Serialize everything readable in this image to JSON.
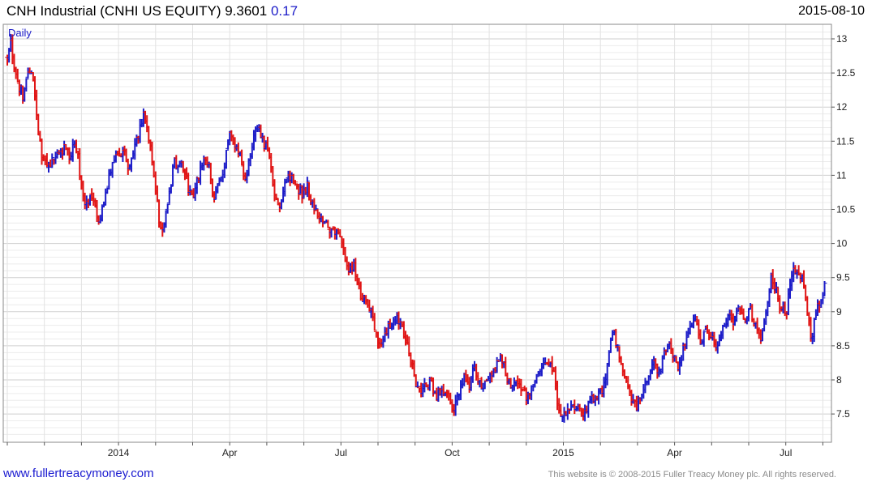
{
  "header": {
    "title": "CNH Industrial (CNHI US EQUITY) 9.3601",
    "change": "0.17",
    "date": "2015-08-10"
  },
  "footer": {
    "website": "www.fullertreacymoney.com",
    "copyright": "This website is © 2008-2015 Fuller Treacy Money plc. All rights reserved."
  },
  "colors": {
    "up": "#1c1cc8",
    "down": "#e01414",
    "grid": "#d6d6d6",
    "frame": "#8a8a8a",
    "change": "#1c1cc8"
  },
  "chart_data": {
    "type": "ohlc-bar",
    "period_label": "Daily",
    "xlabel": "",
    "ylabel": "",
    "ylim": [
      7.2,
      13.1
    ],
    "xlim": [
      -0.1,
      20.4
    ],
    "y_ticks": [
      7.5,
      8,
      8.5,
      9,
      9.5,
      10,
      10.5,
      11,
      11.5,
      12,
      12.5,
      13
    ],
    "x_ticks": [
      {
        "label": "2014",
        "pos": 3
      },
      {
        "label": "Apr",
        "pos": 6
      },
      {
        "label": "Jul",
        "pos": 9
      },
      {
        "label": "Oct",
        "pos": 12
      },
      {
        "label": "2015",
        "pos": 15
      },
      {
        "label": "Apr",
        "pos": 18
      },
      {
        "label": "Jul",
        "pos": 21
      }
    ],
    "grid": true,
    "x_unit": "month index (0 = Oct 2013)",
    "series": [
      {
        "price_path": [
          [
            0.0,
            12.7
          ],
          [
            0.1,
            12.95
          ],
          [
            0.2,
            12.5
          ],
          [
            0.3,
            12.3
          ],
          [
            0.45,
            12.15
          ],
          [
            0.55,
            12.55
          ],
          [
            0.65,
            12.45
          ],
          [
            0.75,
            12.2
          ],
          [
            0.82,
            11.75
          ],
          [
            0.88,
            11.45
          ],
          [
            0.95,
            11.2
          ],
          [
            1.1,
            11.15
          ],
          [
            1.3,
            11.25
          ],
          [
            1.5,
            11.4
          ],
          [
            1.7,
            11.3
          ],
          [
            1.85,
            11.5
          ],
          [
            1.95,
            11.05
          ],
          [
            2.1,
            10.55
          ],
          [
            2.3,
            10.7
          ],
          [
            2.45,
            10.25
          ],
          [
            2.6,
            10.55
          ],
          [
            2.75,
            11.0
          ],
          [
            2.9,
            11.3
          ],
          [
            3.1,
            11.35
          ],
          [
            3.3,
            11.1
          ],
          [
            3.5,
            11.5
          ],
          [
            3.65,
            11.9
          ],
          [
            3.8,
            11.6
          ],
          [
            3.95,
            11.05
          ],
          [
            4.1,
            10.35
          ],
          [
            4.2,
            10.2
          ],
          [
            4.35,
            10.6
          ],
          [
            4.5,
            11.2
          ],
          [
            4.7,
            11.15
          ],
          [
            4.85,
            10.9
          ],
          [
            5.0,
            10.6
          ],
          [
            5.15,
            10.95
          ],
          [
            5.3,
            11.25
          ],
          [
            5.45,
            11.1
          ],
          [
            5.55,
            10.6
          ],
          [
            5.7,
            10.9
          ],
          [
            5.85,
            11.1
          ],
          [
            6.0,
            11.6
          ],
          [
            6.15,
            11.45
          ],
          [
            6.3,
            11.3
          ],
          [
            6.4,
            10.9
          ],
          [
            6.55,
            11.25
          ],
          [
            6.7,
            11.7
          ],
          [
            6.85,
            11.6
          ],
          [
            7.0,
            11.4
          ],
          [
            7.1,
            11.1
          ],
          [
            7.2,
            10.75
          ],
          [
            7.35,
            10.6
          ],
          [
            7.5,
            10.9
          ],
          [
            7.65,
            11.0
          ],
          [
            7.8,
            10.85
          ],
          [
            7.95,
            10.7
          ],
          [
            8.1,
            10.85
          ],
          [
            8.25,
            10.55
          ],
          [
            8.4,
            10.45
          ],
          [
            8.55,
            10.3
          ],
          [
            8.75,
            10.15
          ],
          [
            8.95,
            10.1
          ],
          [
            9.1,
            9.8
          ],
          [
            9.2,
            9.55
          ],
          [
            9.35,
            9.7
          ],
          [
            9.45,
            9.35
          ],
          [
            9.6,
            9.2
          ],
          [
            9.75,
            9.1
          ],
          [
            9.9,
            8.8
          ],
          [
            10.05,
            8.5
          ],
          [
            10.2,
            8.65
          ],
          [
            10.35,
            8.85
          ],
          [
            10.5,
            8.9
          ],
          [
            10.65,
            8.75
          ],
          [
            10.8,
            8.55
          ],
          [
            10.9,
            8.25
          ],
          [
            11.0,
            8.0
          ],
          [
            11.15,
            7.85
          ],
          [
            11.3,
            7.95
          ],
          [
            11.45,
            7.9
          ],
          [
            11.6,
            7.75
          ],
          [
            11.75,
            7.9
          ],
          [
            11.9,
            7.7
          ],
          [
            12.05,
            7.55
          ],
          [
            12.2,
            7.85
          ],
          [
            12.35,
            8.05
          ],
          [
            12.45,
            7.85
          ],
          [
            12.6,
            8.2
          ],
          [
            12.75,
            7.95
          ],
          [
            12.9,
            7.9
          ],
          [
            13.05,
            8.1
          ],
          [
            13.2,
            8.25
          ],
          [
            13.35,
            8.3
          ],
          [
            13.5,
            8.05
          ],
          [
            13.6,
            7.8
          ],
          [
            13.75,
            8.0
          ],
          [
            13.9,
            7.85
          ],
          [
            14.05,
            7.75
          ],
          [
            14.2,
            8.0
          ],
          [
            14.35,
            8.1
          ],
          [
            14.5,
            8.25
          ],
          [
            14.65,
            8.3
          ],
          [
            14.75,
            8.1
          ],
          [
            14.85,
            7.6
          ],
          [
            14.95,
            7.45
          ],
          [
            15.1,
            7.55
          ],
          [
            15.25,
            7.65
          ],
          [
            15.4,
            7.55
          ],
          [
            15.55,
            7.5
          ],
          [
            15.7,
            7.65
          ],
          [
            15.85,
            7.75
          ],
          [
            16.0,
            7.8
          ],
          [
            16.1,
            7.95
          ],
          [
            16.25,
            8.45
          ],
          [
            16.35,
            8.75
          ],
          [
            16.5,
            8.35
          ],
          [
            16.65,
            8.1
          ],
          [
            16.8,
            7.8
          ],
          [
            16.95,
            7.6
          ],
          [
            17.1,
            7.75
          ],
          [
            17.25,
            8.0
          ],
          [
            17.4,
            8.3
          ],
          [
            17.55,
            8.1
          ],
          [
            17.7,
            8.35
          ],
          [
            17.85,
            8.5
          ],
          [
            18.0,
            8.35
          ],
          [
            18.1,
            8.15
          ],
          [
            18.25,
            8.5
          ],
          [
            18.4,
            8.75
          ],
          [
            18.55,
            8.9
          ],
          [
            18.7,
            8.55
          ],
          [
            18.85,
            8.75
          ],
          [
            19.0,
            8.65
          ],
          [
            19.15,
            8.45
          ],
          [
            19.3,
            8.8
          ],
          [
            19.45,
            8.95
          ],
          [
            19.6,
            8.85
          ],
          [
            19.75,
            9.1
          ],
          [
            19.9,
            8.9
          ],
          [
            20.05,
            9.05
          ],
          [
            20.2,
            8.75
          ],
          [
            20.35,
            8.6
          ],
          [
            20.5,
            9.15
          ],
          [
            20.6,
            9.5
          ],
          [
            20.75,
            9.3
          ],
          [
            20.85,
            9.1
          ],
          [
            21.0,
            8.95
          ],
          [
            21.15,
            9.55
          ],
          [
            21.3,
            9.65
          ],
          [
            21.45,
            9.45
          ],
          [
            21.55,
            9.2
          ],
          [
            21.6,
            8.85
          ],
          [
            21.7,
            8.65
          ],
          [
            21.8,
            8.95
          ],
          [
            21.95,
            9.15
          ],
          [
            22.05,
            9.36
          ]
        ]
      }
    ]
  }
}
